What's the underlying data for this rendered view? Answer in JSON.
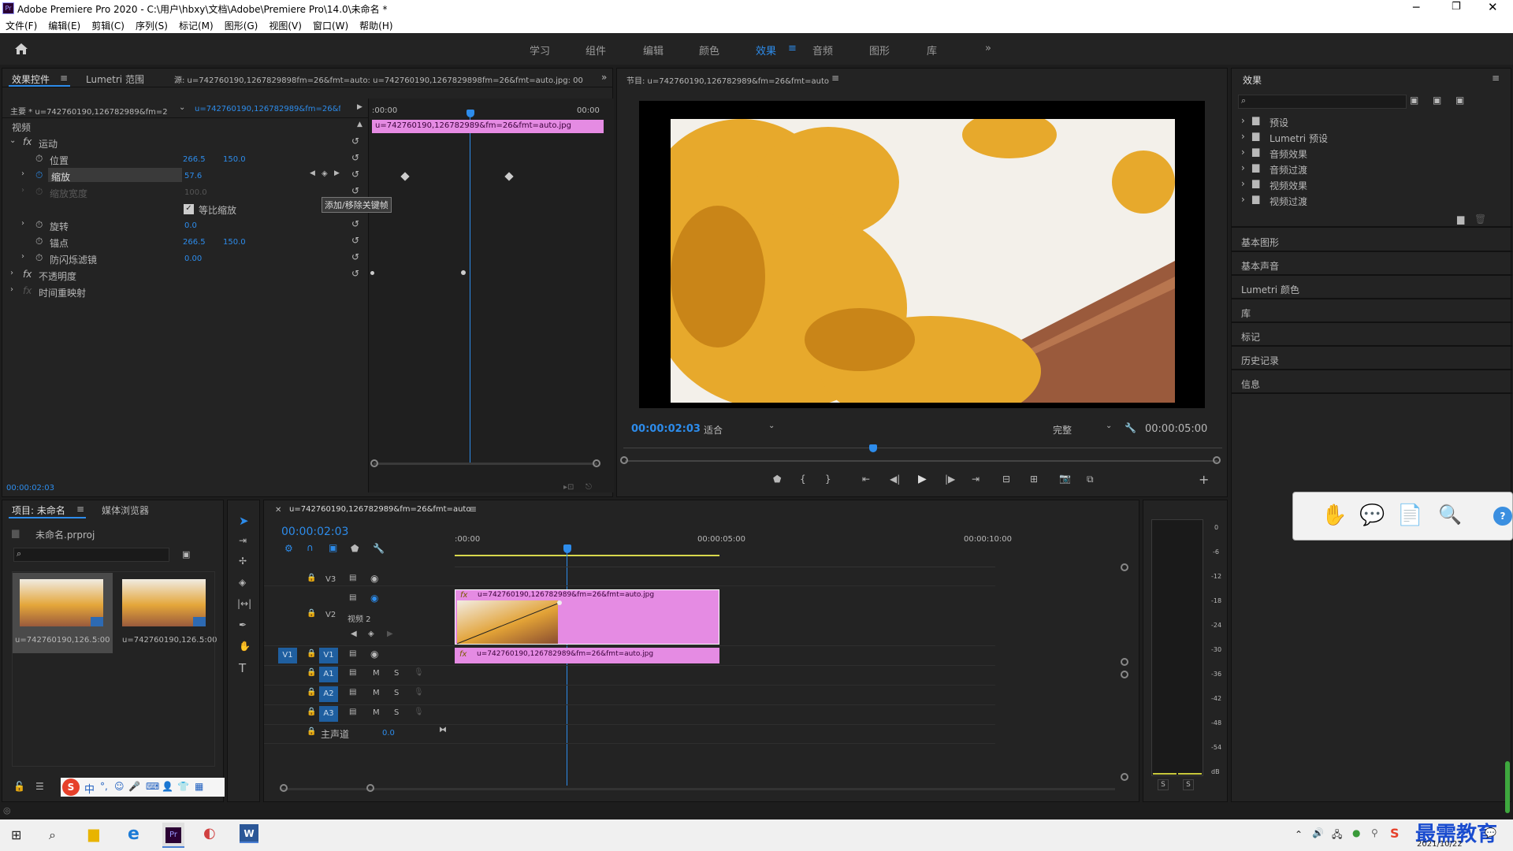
{
  "app": {
    "title": "Adobe Premiere Pro 2020 - C:\\用户\\hbxy\\文档\\Adobe\\Premiere Pro\\14.0\\未命名 *",
    "icon_label": "Pr"
  },
  "menu": [
    "文件(F)",
    "编辑(E)",
    "剪辑(C)",
    "序列(S)",
    "标记(M)",
    "图形(G)",
    "视图(V)",
    "窗口(W)",
    "帮助(H)"
  ],
  "workspaces": [
    "学习",
    "组件",
    "编辑",
    "颜色",
    "效果",
    "音频",
    "图形",
    "库"
  ],
  "active_workspace": "效果",
  "effect_controls": {
    "tab_active": "效果控件",
    "tab_lumetri": "Lumetri 范围",
    "source_label": "源: u=742760190,1267829898fm=26&fmt=auto: u=742760190,1267829898fm=26&fmt=auto.jpg: 00:00:0",
    "master_label": "主要 * u=742760190,126782989&fm=2...",
    "clip_label": "u=742760190,126782989&fm=26&f...",
    "ruler_start": ":00:00",
    "ruler_end": "00:00",
    "clip_bar": "u=742760190,126782989&fm=26&fmt=auto.jpg",
    "section_video": "视频",
    "motion": "运动",
    "position": "位置",
    "position_x": "266.5",
    "position_y": "150.0",
    "scale": "缩放",
    "scale_val": "57.6",
    "scale_width": "缩放宽度",
    "scale_width_val": "100.0",
    "uniform_scale": "等比缩放",
    "tooltip": "添加/移除关键帧",
    "rotation": "旋转",
    "rotation_val": "0.0",
    "anchor": "锚点",
    "anchor_x": "266.5",
    "anchor_y": "150.0",
    "antiflicker": "防闪烁滤镜",
    "antiflicker_val": "0.00",
    "opacity": "不透明度",
    "time_remap": "时间重映射",
    "timecode": "00:00:02:03"
  },
  "program": {
    "title": "节目: u=742760190,126782989&fm=26&fmt=auto",
    "timecode": "00:00:02:03",
    "fit": "适合",
    "quality": "完整",
    "duration": "00:00:05:00"
  },
  "effects_panel": {
    "title": "效果",
    "tree": [
      "预设",
      "Lumetri 预设",
      "音频效果",
      "音频过渡",
      "视频效果",
      "视频过渡"
    ],
    "sections": [
      "基本图形",
      "基本声音",
      "Lumetri 颜色",
      "库",
      "标记",
      "历史记录",
      "信息"
    ]
  },
  "project": {
    "tab_active": "项目: 未命名",
    "tab_media": "媒体浏览器",
    "file": "未命名.prproj",
    "items": [
      {
        "name": "u=742760190,126...",
        "duration": "5:00"
      },
      {
        "name": "u=742760190,126...",
        "duration": "5:00"
      }
    ]
  },
  "timeline": {
    "title": "u=742760190,126782989&fm=26&fmt=auto",
    "timecode": "00:00:02:03",
    "ruler": [
      ":00:00",
      "00:00:05:00",
      "00:00:10:00"
    ],
    "tracks": {
      "v3": "V3",
      "v2": "V2",
      "v2_name": "视频 2",
      "v1": "V1",
      "v1_src": "V1",
      "a1": "A1",
      "a2": "A2",
      "a3": "A3",
      "master": "主声道",
      "master_val": "0.0"
    },
    "clip_v2": "u=742760190,126782989&fm=26&fmt=auto.jpg",
    "clip_v1": "u=742760190,126782989&fm=26&fmt=auto.jpg",
    "m": "M",
    "s": "S",
    "fx": "fx"
  },
  "meter": {
    "scale": [
      "0",
      "-6",
      "-12",
      "-18",
      "-24",
      "-30",
      "-36",
      "-42",
      "-48",
      "-54",
      "dB"
    ],
    "s1": "S",
    "s2": "S"
  },
  "ime": {
    "logo": "S",
    "items": [
      "中",
      "°,",
      "☺",
      "🎤",
      "⌨",
      "👤",
      "👕",
      "▦"
    ]
  },
  "taskbar": {
    "date": "2021/10/22",
    "watermark": "最需教育"
  }
}
